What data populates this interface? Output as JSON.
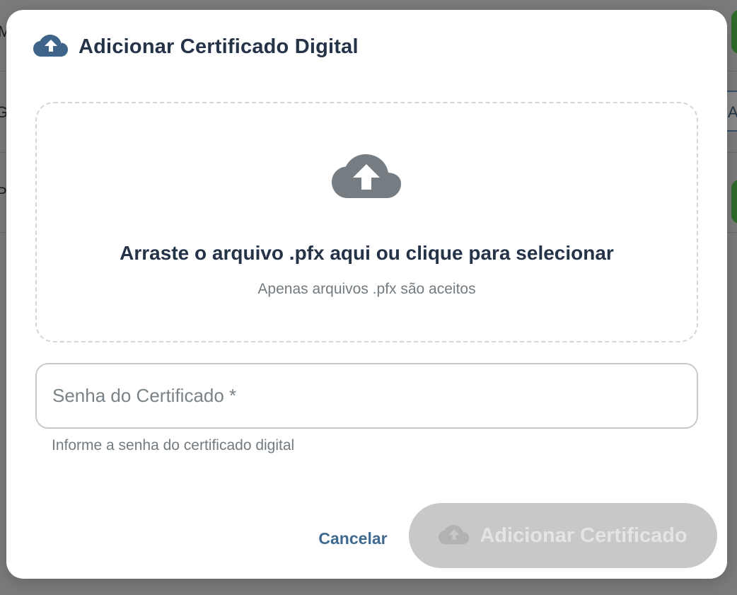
{
  "background": {
    "fragments": [
      "M",
      "G",
      "P",
      "A"
    ]
  },
  "dialog": {
    "title": "Adicionar Certificado Digital",
    "header_icon": "cloud-upload-icon",
    "dropzone": {
      "icon": "cloud-upload-icon",
      "title": "Arraste o arquivo .pfx aqui ou clique para selecionar",
      "subtitle": "Apenas arquivos .pfx são aceitos"
    },
    "password_field": {
      "placeholder": "Senha do Certificado *",
      "value": "",
      "helper": "Informe a senha do certificado digital"
    },
    "actions": {
      "cancel_label": "Cancelar",
      "submit_label": "Adicionar Certificado",
      "submit_icon": "cloud-upload-icon",
      "submit_disabled": true
    }
  },
  "colors": {
    "primary_text": "#253349",
    "accent": "#3f6a90",
    "icon_header": "#3e6589",
    "icon_dropzone": "#767d82",
    "disabled_button_bg": "#c8c8c8"
  }
}
